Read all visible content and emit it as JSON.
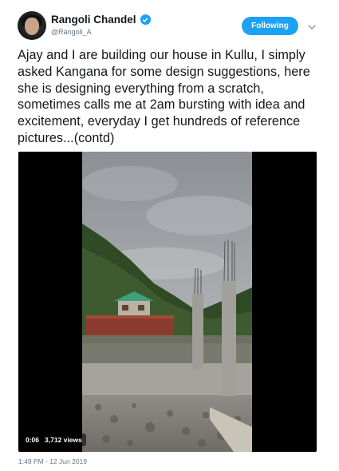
{
  "author": {
    "name": "Rangoli Chandel",
    "handle": "@Rangoli_A",
    "verified_icon": "verified-badge-icon"
  },
  "follow_button": {
    "label": "Following"
  },
  "tweet": {
    "text": "Ajay and I are building our house in Kullu, I simply asked Kangana for some design suggestions, here she is designing everything from a scratch, sometimes calls me at 2am bursting with idea and excitement, everyday I get hundreds of reference pictures...(contd)"
  },
  "video": {
    "current_time": "0:06",
    "views": "3,712 views"
  },
  "timestamp": "1:49 PM - 12 Jun 2019",
  "colors": {
    "accent": "#1da1f2",
    "text": "#14171a",
    "secondary_text": "#657786"
  }
}
